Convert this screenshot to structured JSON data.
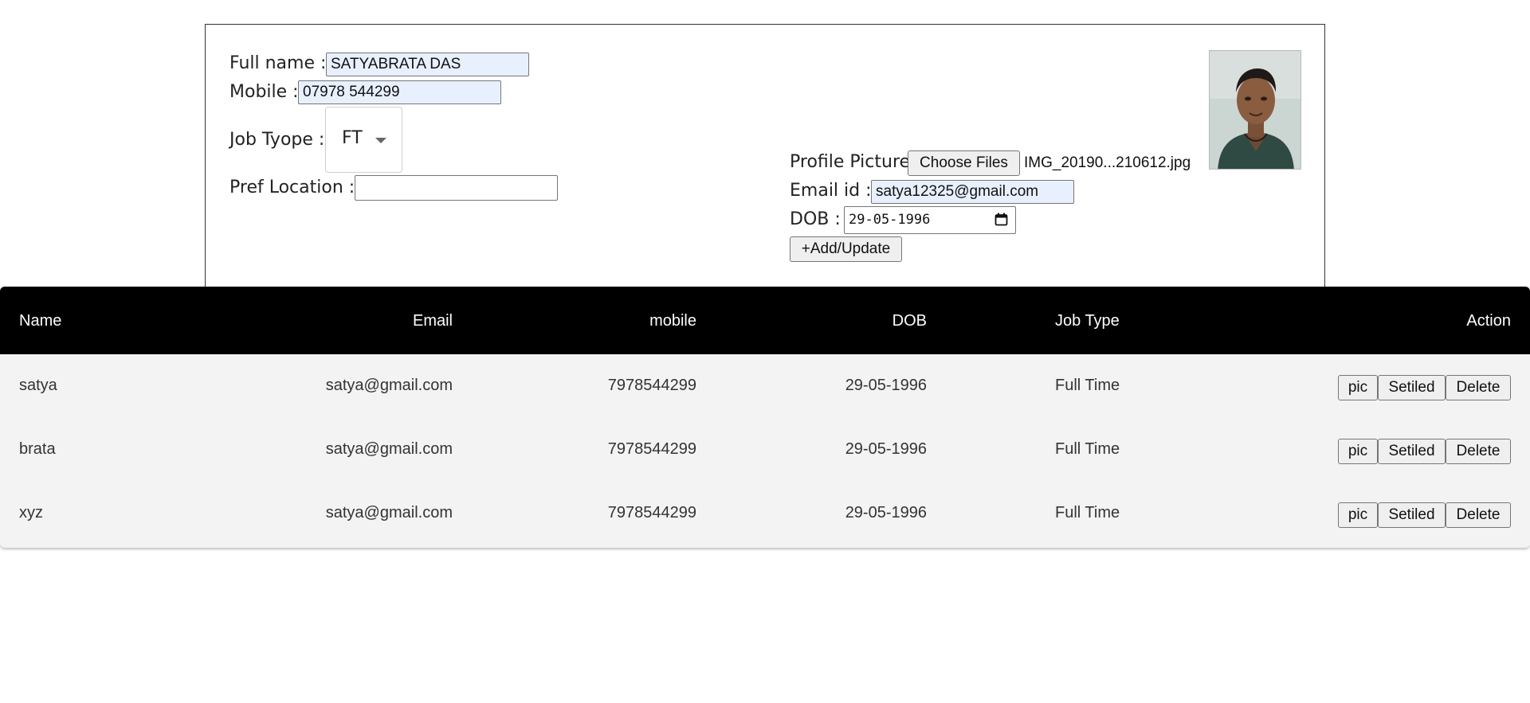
{
  "form": {
    "full_name_label": "Full name :",
    "full_name_value": "SATYABRATA DAS",
    "mobile_label": "Mobile :",
    "mobile_value": "07978 544299",
    "job_type_label": "Job Tyope :",
    "job_type_value": "FT",
    "pref_location_label": "Pref Location :",
    "pref_location_value": "",
    "profile_picture_label": "Profile Picture",
    "choose_files_label": "Choose Files",
    "selected_file": "IMG_20190...210612.jpg",
    "email_label": "Email id :",
    "email_value": "satya12325@gmail.com",
    "dob_label": "DOB :",
    "dob_value": "29-05-1996",
    "submit_label": "+Add/Update"
  },
  "table": {
    "headers": {
      "name": "Name",
      "email": "Email",
      "mobile": "mobile",
      "dob": "DOB",
      "job_type": "Job Type",
      "action": "Action"
    },
    "rows": [
      {
        "name": "satya",
        "email": "satya@gmail.com",
        "mobile": "7978544299",
        "dob": "29-05-1996",
        "job_type": "Full Time"
      },
      {
        "name": "brata",
        "email": "satya@gmail.com",
        "mobile": "7978544299",
        "dob": "29-05-1996",
        "job_type": "Full Time"
      },
      {
        "name": "xyz",
        "email": "satya@gmail.com",
        "mobile": "7978544299",
        "dob": "29-05-1996",
        "job_type": "Full Time"
      }
    ],
    "actions": {
      "pic": "pic",
      "settled": "Setiled",
      "delete": "Delete"
    }
  },
  "colors": {
    "header_bg": "#000000",
    "row_bg": "#f3f3f3",
    "autofill_bg": "#e8f0fe"
  }
}
